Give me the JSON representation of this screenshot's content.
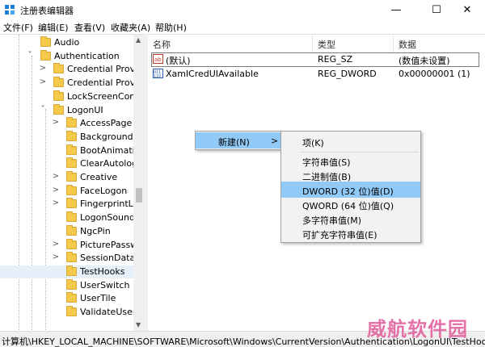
{
  "window": {
    "title": "注册表编辑器",
    "minimize": "—",
    "maximize": "☐",
    "close": "✕"
  },
  "menubar": [
    {
      "label": "文件(F)"
    },
    {
      "label": "编辑(E)"
    },
    {
      "label": "查看(V)"
    },
    {
      "label": "收藏夹(A)"
    },
    {
      "label": "帮助(H)"
    }
  ],
  "tree": [
    {
      "label": "Audio",
      "expander": "",
      "selected": false
    },
    {
      "label": "Authentication",
      "expander": "˅",
      "selected": false
    },
    {
      "label": "Credential Provic",
      "expander": ">",
      "selected": false
    },
    {
      "label": "Credential Provic",
      "expander": ">",
      "selected": false
    },
    {
      "label": "LockScreenConte",
      "expander": "",
      "selected": false
    },
    {
      "label": "LogonUI",
      "expander": "˅",
      "selected": false
    },
    {
      "label": "AccessPage",
      "expander": ">",
      "selected": false
    },
    {
      "label": "Background",
      "expander": "",
      "selected": false
    },
    {
      "label": "BootAnimatio",
      "expander": "",
      "selected": false
    },
    {
      "label": "ClearAutologo",
      "expander": "",
      "selected": false
    },
    {
      "label": "Creative",
      "expander": ">",
      "selected": false
    },
    {
      "label": "FaceLogon",
      "expander": ">",
      "selected": false
    },
    {
      "label": "FingerprintLo",
      "expander": ">",
      "selected": false
    },
    {
      "label": "LogonSoundP",
      "expander": "",
      "selected": false
    },
    {
      "label": "NgcPin",
      "expander": "",
      "selected": false
    },
    {
      "label": "PicturePasswo",
      "expander": ">",
      "selected": false
    },
    {
      "label": "SessionData",
      "expander": ">",
      "selected": false
    },
    {
      "label": "TestHooks",
      "expander": "",
      "selected": true
    },
    {
      "label": "UserSwitch",
      "expander": "",
      "selected": false
    },
    {
      "label": "UserTile",
      "expander": "",
      "selected": false
    },
    {
      "label": "ValidateUserr",
      "expander": "",
      "selected": false
    }
  ],
  "list": {
    "columns": [
      "名称",
      "类型",
      "数据"
    ],
    "rows": [
      {
        "name": "(默认)",
        "type": "REG_SZ",
        "data": "(数值未设置)",
        "icon": "string-value-icon"
      },
      {
        "name": "XamlCredUIAvailable",
        "type": "REG_DWORD",
        "data": "0x00000001 (1)",
        "icon": "binary-value-icon"
      }
    ]
  },
  "context_menu": {
    "new_label": "新建(N)",
    "new_arrow": ">",
    "submenu": [
      {
        "label": "项(K)",
        "highlighted": false
      },
      {
        "label": "字符串值(S)",
        "highlighted": false
      },
      {
        "label": "二进制值(B)",
        "highlighted": false
      },
      {
        "label": "DWORD (32 位)值(D)",
        "highlighted": true
      },
      {
        "label": "QWORD (64 位)值(Q)",
        "highlighted": false
      },
      {
        "label": "多字符串值(M)",
        "highlighted": false
      },
      {
        "label": "可扩充字符串值(E)",
        "highlighted": false
      }
    ]
  },
  "statusbar": {
    "path": "计算机\\HKEY_LOCAL_MACHINE\\SOFTWARE\\Microsoft\\Windows\\CurrentVersion\\Authentication\\LogonUI\\TestHooks"
  },
  "watermark": "威航软件园",
  "colors": {
    "selection": "#e5f0fa",
    "menu_highlight": "#91c9f7",
    "folder": "#f5c94a",
    "watermark": "#e05a9a"
  }
}
